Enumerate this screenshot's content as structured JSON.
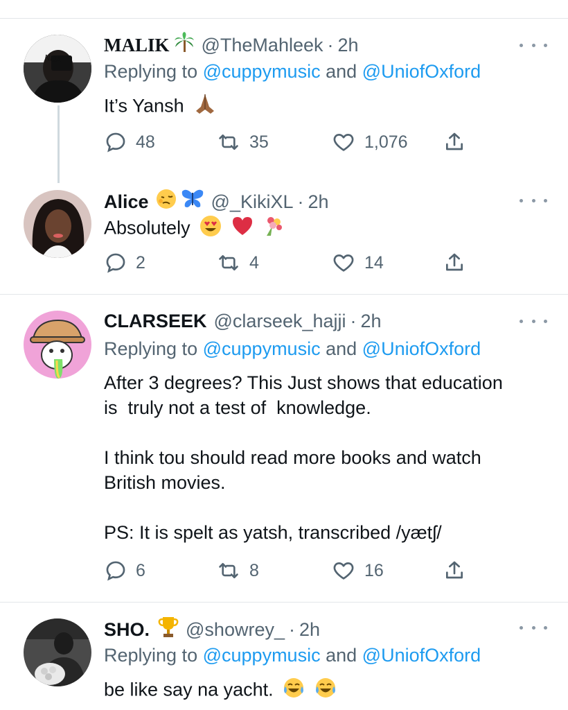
{
  "tweets": [
    {
      "name": "MALIK",
      "name_emoji": "palm-tree",
      "handle": "@TheMahleek",
      "sep": "·",
      "time": "2h",
      "replying_prefix": "Replying to",
      "mention1": "@cuppymusic",
      "and": "and",
      "mention2": "@UniofOxford",
      "text": "It’s Yansh",
      "text_emoji": "folded-hands",
      "replies": "48",
      "retweets": "35",
      "likes": "1,076"
    },
    {
      "name": "Alice",
      "name_emoji": "woozy-face, butterfly",
      "handle": "@_KikiXL",
      "sep": "·",
      "time": "2h",
      "text": "Absolutely",
      "text_emoji": "heart-eyes, red-heart, bouquet",
      "replies": "2",
      "retweets": "4",
      "likes": "14"
    },
    {
      "name": "CLARSEEK",
      "handle": "@clarseek_hajji",
      "sep": "·",
      "time": "2h",
      "replying_prefix": "Replying to",
      "mention1": "@cuppymusic",
      "and": "and",
      "mention2": "@UniofOxford",
      "text_p1_line1": "After 3 degrees? This Just shows that education",
      "text_p1_line2": "is  truly not a test of  knowledge.",
      "text_p2_line1": "I think tou should read more books and watch",
      "text_p2_line2": "British movies.",
      "text_p3": "PS: It is spelt as yatsh, transcribed /yætʃ/",
      "replies": "6",
      "retweets": "8",
      "likes": "16"
    },
    {
      "name": "SHO.",
      "name_emoji": "trophy",
      "handle": "@showrey_",
      "sep": "·",
      "time": "2h",
      "replying_prefix": "Replying to",
      "mention1": "@cuppymusic",
      "and": "and",
      "mention2": "@UniofOxford",
      "text": "be like say na yacht.",
      "text_emoji": "tears-of-joy, tears-of-joy"
    }
  ],
  "colors": {
    "text": "#0f1419",
    "secondary": "#536471",
    "link": "#1d9bf0",
    "divider": "#e3e6e9"
  }
}
